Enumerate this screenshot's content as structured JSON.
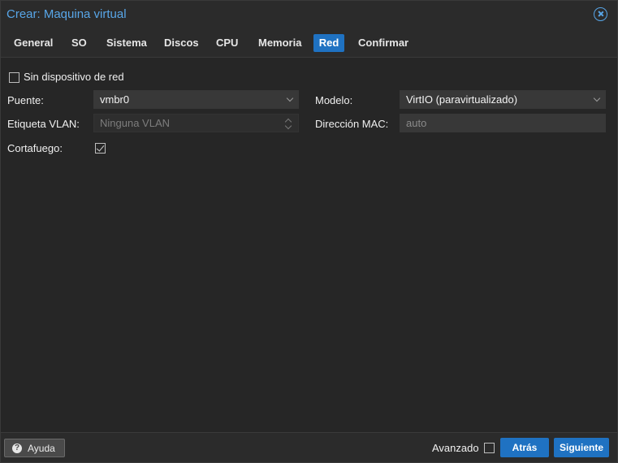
{
  "dialog": {
    "title": "Crear: Maquina virtual"
  },
  "tabs": [
    {
      "label": "General"
    },
    {
      "label": "SO"
    },
    {
      "label": "Sistema"
    },
    {
      "label": "Discos"
    },
    {
      "label": "CPU"
    },
    {
      "label": "Memoria"
    },
    {
      "label": "Red",
      "active": true
    },
    {
      "label": "Confirmar"
    }
  ],
  "form": {
    "no_network": {
      "label": "Sin dispositivo de red",
      "checked": false
    },
    "bridge": {
      "label": "Puente:",
      "value": "vmbr0"
    },
    "vlan_tag": {
      "label": "Etiqueta VLAN:",
      "placeholder": "Ninguna VLAN"
    },
    "firewall": {
      "label": "Cortafuego:",
      "checked": true
    },
    "model": {
      "label": "Modelo:",
      "value": "VirtIO (paravirtualizado)"
    },
    "mac_address": {
      "label": "Dirección MAC:",
      "placeholder": "auto"
    }
  },
  "footer": {
    "help_label": "Ayuda",
    "advanced_label": "Avanzado",
    "advanced_checked": false,
    "back_label": "Atrás",
    "next_label": "Siguiente"
  },
  "colors": {
    "accent": "#1f72c2",
    "title": "#58a6e8",
    "background": "#262626"
  },
  "icons": {
    "close": "close-circle-icon",
    "help": "question-circle-icon"
  }
}
